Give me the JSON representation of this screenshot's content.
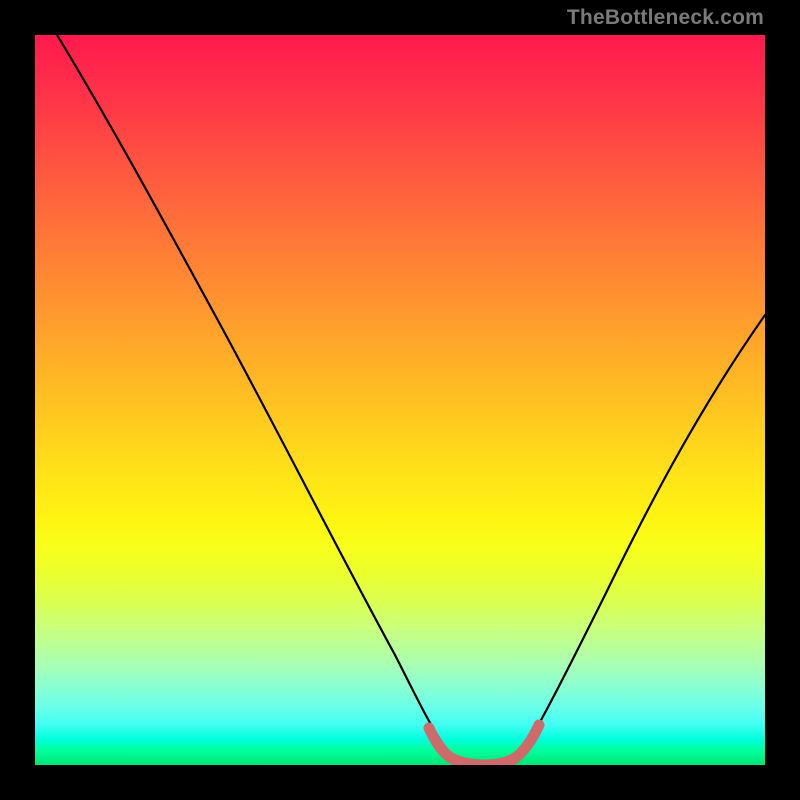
{
  "watermark": "TheBottleneck.com",
  "chart_data": {
    "type": "line",
    "title": "",
    "xlabel": "",
    "ylabel": "",
    "xlim": [
      0,
      100
    ],
    "ylim": [
      0,
      100
    ],
    "grid": false,
    "legend": false,
    "series": [
      {
        "name": "bottleneck-curve",
        "color": "#000000",
        "x": [
          0,
          5,
          10,
          15,
          20,
          25,
          30,
          35,
          40,
          45,
          50,
          52,
          54,
          56,
          58,
          60,
          62,
          64,
          66,
          68,
          72,
          76,
          80,
          84,
          88,
          92,
          96,
          100
        ],
        "values": [
          105,
          95,
          85,
          76,
          67,
          58,
          49,
          41,
          33,
          25,
          17,
          13,
          9,
          5,
          2,
          0,
          0,
          0,
          2,
          4,
          9,
          15,
          22,
          29,
          37,
          45,
          54,
          62
        ]
      },
      {
        "name": "optimal-range-highlight",
        "color": "#d46a6a",
        "x": [
          54,
          56,
          58,
          60,
          62,
          64,
          66,
          68
        ],
        "values": [
          5,
          2,
          0.5,
          0,
          0,
          0.5,
          2,
          4
        ]
      }
    ],
    "background_gradient_stops": [
      {
        "pos": 0.0,
        "color": "#ff1a4d"
      },
      {
        "pos": 0.5,
        "color": "#ffd21c"
      },
      {
        "pos": 0.72,
        "color": "#f0ff25"
      },
      {
        "pos": 0.88,
        "color": "#9affc0"
      },
      {
        "pos": 1.0,
        "color": "#00e676"
      }
    ]
  }
}
